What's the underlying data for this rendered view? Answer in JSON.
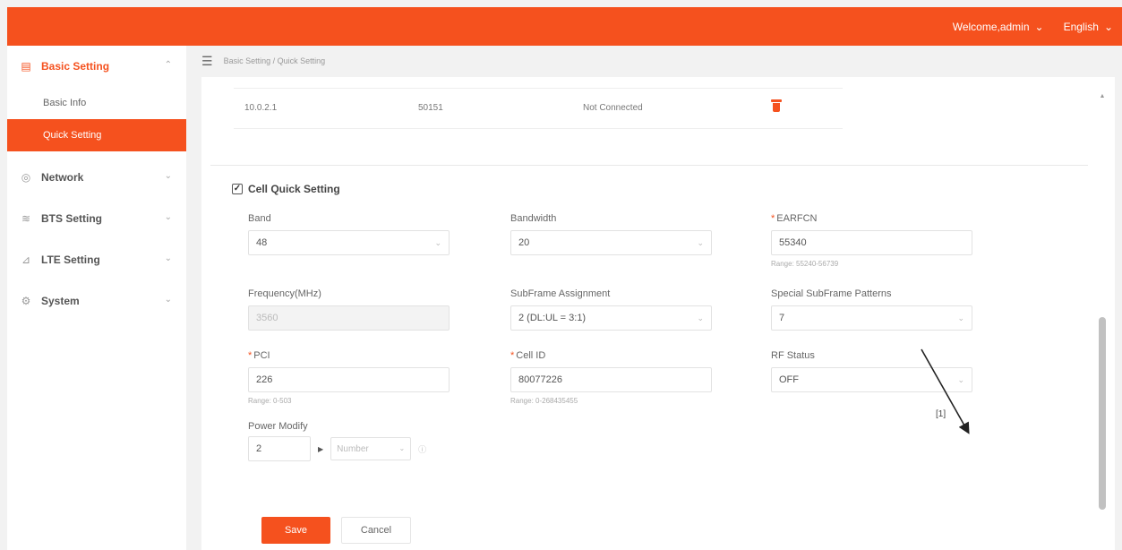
{
  "header": {
    "welcome": "Welcome,admin",
    "language": "English"
  },
  "sidebar": {
    "groups": [
      {
        "label": "Basic Setting",
        "icon": "basic-setting-icon"
      },
      {
        "label": "Network",
        "icon": "network-icon"
      },
      {
        "label": "BTS Setting",
        "icon": "bts-icon"
      },
      {
        "label": "LTE Setting",
        "icon": "lte-icon"
      },
      {
        "label": "System",
        "icon": "system-icon"
      }
    ],
    "subitems": [
      {
        "label": "Basic Info"
      },
      {
        "label": "Quick Setting"
      }
    ]
  },
  "breadcrumb": "Basic Setting / Quick Setting",
  "connection_row": {
    "address": "10.0.2.1",
    "port": "50151",
    "status": "Not Connected"
  },
  "cell_section": {
    "title": "Cell Quick Setting",
    "checked_mark": "✓"
  },
  "fields": {
    "band": {
      "label": "Band",
      "value": "48"
    },
    "bandwidth": {
      "label": "Bandwidth",
      "value": "20"
    },
    "earfcn": {
      "label": "EARFCN",
      "value": "55340",
      "hint": "Range: 55240-56739"
    },
    "frequency": {
      "label": "Frequency(MHz)",
      "value": "3560"
    },
    "subframe": {
      "label": "SubFrame Assignment",
      "value": "2 (DL:UL = 3:1)"
    },
    "special_subframe": {
      "label": "Special SubFrame Patterns",
      "value": "7"
    },
    "pci": {
      "label": "PCI",
      "value": "226",
      "hint": "Range: 0-503"
    },
    "cell_id": {
      "label": "Cell ID",
      "value": "80077226",
      "hint": "Range: 0-268435455"
    },
    "rf_status": {
      "label": "RF Status",
      "value": "OFF"
    },
    "power_modify": {
      "label": "Power Modify",
      "value": "2",
      "unit_placeholder": "Number"
    }
  },
  "buttons": {
    "save": "Save",
    "cancel": "Cancel"
  },
  "annotation": {
    "label": "[1]"
  }
}
